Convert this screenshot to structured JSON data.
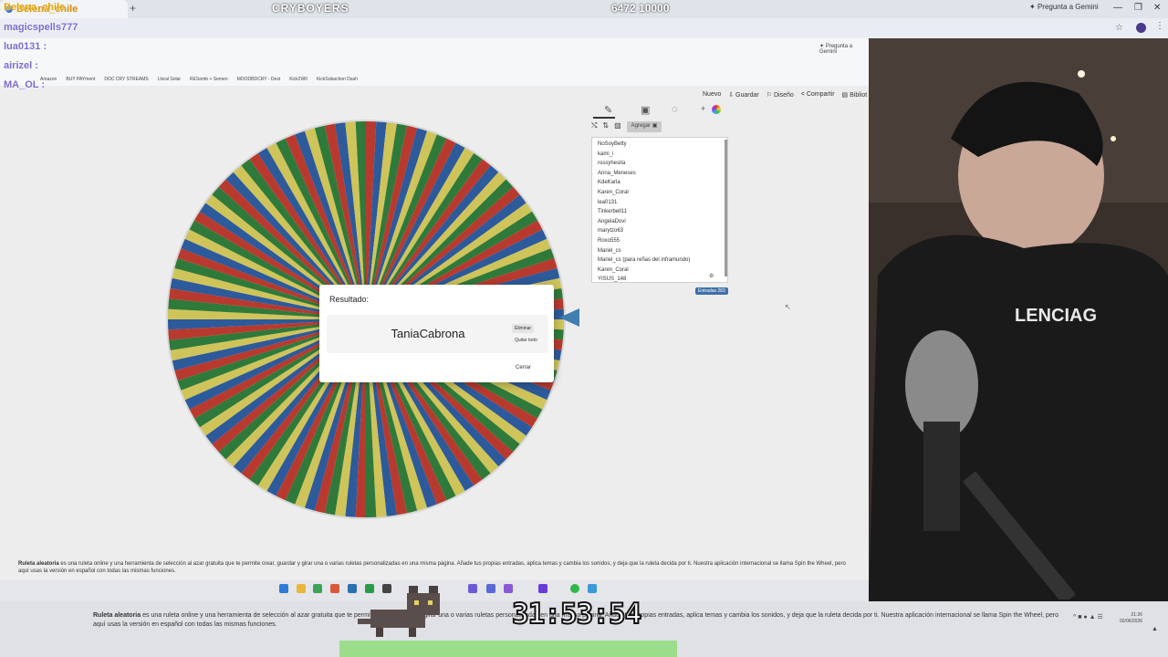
{
  "outer_browser": {
    "tab_title": "Belena_chile",
    "stream_title": "CRYBOYERS",
    "counter": "6472  10000",
    "gemini_label": "Pregunta a Gemini",
    "progress_fraction": 0.64
  },
  "chat": [
    {
      "user": "magicspells777",
      "message": ""
    },
    {
      "user": "lua0131",
      "message": ":"
    },
    {
      "user": "airizel",
      "message": ":"
    },
    {
      "user": "MA_OL",
      "message": ":"
    }
  ],
  "inner_browser": {
    "gemini_label": "Pregunta a Gemini",
    "bookmarks": [
      "Amazon",
      "BUY PAYment",
      "DOC CRY STREAMS",
      "Lloral Solar",
      "RESomb + Semen",
      "MOODBDCRY - Dest",
      "Kick2W0",
      "KickSobachon Dash"
    ]
  },
  "toolbar": {
    "new_label": "Nuevo",
    "save_label": "Guardar",
    "design_label": "Diseño",
    "share_label": "Compartir",
    "library_label": "Bibliot"
  },
  "editor": {
    "add_label": "Agregar",
    "entries": [
      "NoSoyBetty",
      "kami_i",
      "rossyhesita",
      "Anna_Meneses",
      "KdeKarla",
      "Karen_Coral",
      "lea0131",
      "Tinkerbell11",
      "AngelaDovi",
      "marytzo63",
      "Roxo555",
      "Mariel_cs",
      "Mariel_cs (para reñas del inframundo)",
      "Karen_Coral",
      "YISUS_148"
    ],
    "entries_count": "Entradas 283"
  },
  "wheel": {
    "segment_colors": [
      "#cfc45a",
      "#2f7a3a",
      "#b83a2e",
      "#2d5a9a"
    ],
    "segment_count": 120
  },
  "dialog": {
    "title": "Resultado:",
    "winner": "TaniaCabrona",
    "remove_label": "Eliminar",
    "remove_all_label": "Quitar todo",
    "close_label": "Cerrar"
  },
  "description": {
    "bold": "Ruleta aleatoria",
    "text": " es una ruleta online y una herramienta de selección al azar gratuita que te permite crear, guardar y girar una o varias ruletas personalizadas en una misma página. Añade tus propias entradas, aplica temas y cambia los sonidos, y deja que la ruleta decida por ti. Nuestra aplicación internacional se llama Spin the Wheel, pero aquí usas la versión en español con todas las mismas funciones."
  },
  "overlay": {
    "timer": "31:53:54"
  },
  "clock": {
    "time": "21:26",
    "date": "02/06/2026"
  },
  "icons": [
    "pencil-icon",
    "clipboard-icon",
    "hide-icon",
    "shuffle-icon",
    "sort-icon",
    "image-icon",
    "palette-icon",
    "cursor-icon"
  ]
}
